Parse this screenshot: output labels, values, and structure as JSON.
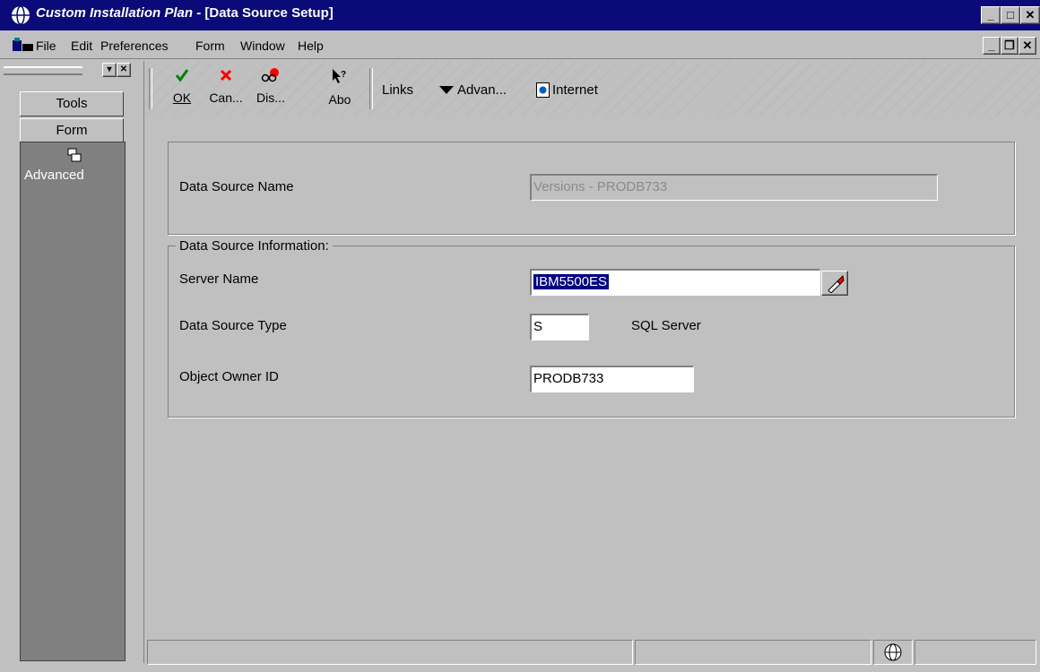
{
  "window": {
    "app_title": "Custom Installation Plan",
    "separator": " - ",
    "doc_title": "[Data Source Setup]"
  },
  "menu": [
    {
      "label": "File"
    },
    {
      "label": "Edit"
    },
    {
      "label": "Preferences"
    },
    {
      "label": "Form"
    },
    {
      "label": "Window"
    },
    {
      "label": "Help"
    }
  ],
  "left_panel": {
    "tools_label": "Tools",
    "form_label": "Form",
    "advanced_label": "Advanced"
  },
  "toolbar": {
    "ok": "OK",
    "cancel": "Can...",
    "display": "Dis...",
    "about": "Abo",
    "links": "Links",
    "advanced": "Advan...",
    "internet": "Internet"
  },
  "form": {
    "data_source_name_label": "Data Source Name",
    "data_source_name_value": "Versions - PRODB733",
    "group_title": "Data Source Information:",
    "server_name_label": "Server Name",
    "server_name_value": "IBM5500ES",
    "data_source_type_label": "Data Source Type",
    "data_source_type_value": "S",
    "data_source_type_desc": "SQL Server",
    "object_owner_label": "Object Owner ID",
    "object_owner_value": "PRODB733"
  },
  "colors": {
    "titlebar": "#0a0a78",
    "selection": "#000080",
    "ok_check": "#008000",
    "cancel_x": "#ff0000"
  }
}
